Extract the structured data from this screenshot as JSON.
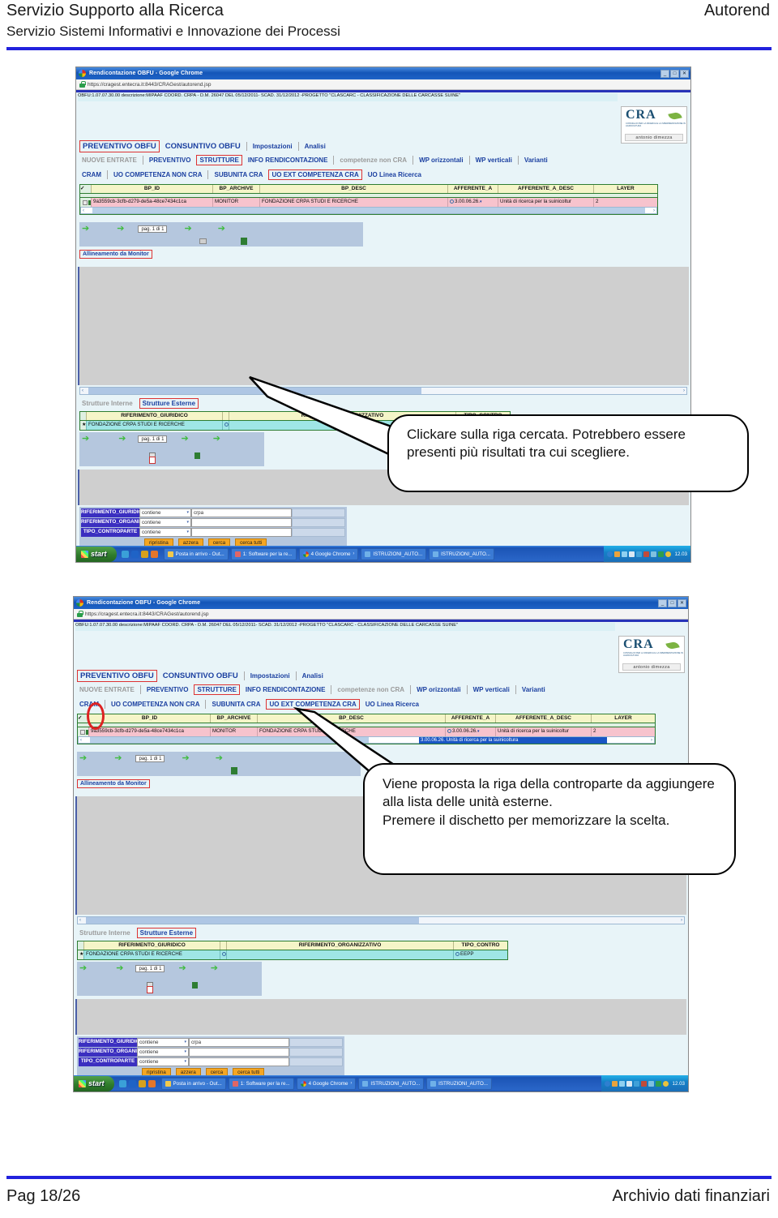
{
  "header": {
    "line1": "Servizio Supporto alla Ricerca",
    "line2": "Servizio Sistemi Informativi e Innovazione dei Processi",
    "right": "Autorend"
  },
  "footer": {
    "left": "Pag 18/26",
    "right": "Archivio dati finanziari"
  },
  "colors": {
    "rule": "#2222dd",
    "annotation_red": "#dd2222",
    "tab_blue": "#1a3fa0",
    "row_pink": "#f7c3cd",
    "row_cyan": "#9fe6e6",
    "header_yellow": "#f5f5c8",
    "filter_label": "#3b2fc0",
    "filter_button": "#f5a623"
  },
  "browser": {
    "title": "Rendicontazione OBFU - Google Chrome",
    "url": "https://cragest.entecra.it:8443/CRAGest/autorend.jsp",
    "window_buttons": [
      "_",
      "□",
      "✕"
    ]
  },
  "app": {
    "project_bar": "OBFU:1.07.07.30.00 descrizione:MIPAAF COORD. CRPA - D.M. 26047 DEL 05/12/2011- SCAD. 31/12/2012 -PROGETTO \"CLASCARC - CLASSIFICAZIONE DELLE CARCASSE SUINE\"",
    "logo": {
      "word": "CRA",
      "subtitle": "CONSIGLIO PER LA RICERCA E LA SPERIMENTAZIONE IN AGRICOLTURA",
      "user": "antonio dimezza"
    },
    "nav_row1": [
      {
        "label": "PREVENTIVO OBFU",
        "state": "selected"
      },
      {
        "label": "CONSUNTIVO OBFU",
        "state": "normal"
      },
      {
        "label": "Impostazioni",
        "state": "normal"
      },
      {
        "label": "Analisi",
        "state": "normal"
      }
    ],
    "nav_row2": [
      {
        "label": "NUOVE ENTRATE",
        "state": "disabled"
      },
      {
        "label": "PREVENTIVO",
        "state": "normal"
      },
      {
        "label": "STRUTTURE",
        "state": "selected"
      },
      {
        "label": "INFO RENDICONTAZIONE",
        "state": "normal"
      },
      {
        "label": "competenze non CRA",
        "state": "disabled"
      },
      {
        "label": "WP orizzontali",
        "state": "normal"
      },
      {
        "label": "WP verticali",
        "state": "normal"
      },
      {
        "label": "Varianti",
        "state": "normal"
      }
    ],
    "nav_row3": [
      {
        "label": "CRAM",
        "state": "normal"
      },
      {
        "label": "UO COMPETENZA NON CRA",
        "state": "normal"
      },
      {
        "label": "SUBUNITA CRA",
        "state": "normal"
      },
      {
        "label": "UO EXT COMPETENZA CRA",
        "state": "selected"
      },
      {
        "label": "UO Linea Ricerca",
        "state": "normal"
      }
    ],
    "grid_bp": {
      "columns": [
        "BP_ID",
        "BP_ARCHIVE",
        "BP_DESC",
        "AFFERENTE_A",
        "AFFERENTE_A_DESC",
        "LAYER"
      ],
      "rows": [
        {
          "bp_id": "9a3559cb-3cfb-d279-de5a-48ce7434c1ca",
          "bp_archive": "MONITOR",
          "bp_desc": "FONDAZIONE CRPA STUDI E RICERCHE",
          "afferente_a": "3.00.06.26.",
          "afferente_a_desc": "Unità di ricerca per la suinicoltur",
          "layer": "2"
        }
      ],
      "dropdown_open_value": "3.00.06.26.   Unità di ricerca per la suinicoltura"
    },
    "pager": {
      "label": "pag. 1 di 1"
    },
    "align_button": "Allineamento da Monitor",
    "struct_tabs": [
      {
        "label": "Strutture Interne",
        "state": "disabled"
      },
      {
        "label": "Strutture Esterne",
        "state": "selected"
      }
    ],
    "grid_ref": {
      "columns": [
        "RIFERIMENTO_GIURIDICO",
        "RIFERIMENTO_ORGANIZZATIVO",
        "TIPO_CONTRO"
      ],
      "rows": [
        {
          "riferimento_giuridico": "FONDAZIONE CRPA STUDI E RICERCHE",
          "riferimento_organizzativo": "",
          "tipo_controparte": "EEPP"
        }
      ]
    },
    "filter": {
      "rows": [
        {
          "label": "RIFERIMENTO_GIURIDIC",
          "operator": "contiene",
          "value": "crpa"
        },
        {
          "label": "RIFERIMENTO_ORGANIZ",
          "operator": "contiene",
          "value": ""
        },
        {
          "label": "TIPO_CONTROPARTE",
          "operator": "contiene",
          "value": ""
        }
      ],
      "buttons": [
        "ripristina",
        "azzera",
        "cerca",
        "cerca tutti"
      ]
    }
  },
  "taskbar": {
    "start": "start",
    "tasks": [
      "Posta in arrivo - Out...",
      "1: Software per la re...",
      "4 Google Chrome",
      "ISTRUZIONI_AUTO...",
      "ISTRUZIONI_AUTO..."
    ],
    "clock": "12.03"
  },
  "callouts": {
    "first": "Clickare sulla riga cercata. Potrebbero essere presenti più risultati tra cui scegliere.",
    "second": "Viene proposta la riga della controparte da aggiungere alla lista delle unità esterne.\nPremere il dischetto per memorizzare la scelta."
  }
}
